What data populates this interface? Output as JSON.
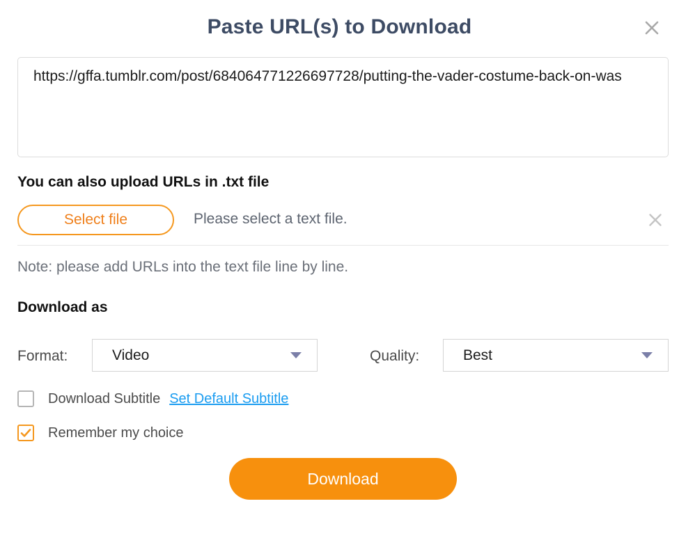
{
  "dialog": {
    "title": "Paste URL(s) to Download",
    "close_icon": "close-icon"
  },
  "url_input": {
    "value": "https://gffa.tumblr.com/post/684064771226697728/putting-the-vader-costume-back-on-was",
    "placeholder": "Paste URL(s) here"
  },
  "upload": {
    "heading": "You can also upload URLs in .txt file",
    "select_file_label": "Select file",
    "file_status": "Please select a text file.",
    "clear_icon": "close-icon",
    "note": "Note: please add URLs into the text file line by line."
  },
  "download_as": {
    "heading": "Download as",
    "format": {
      "label": "Format:",
      "value": "Video",
      "chevron": "chevron-down-icon"
    },
    "quality": {
      "label": "Quality:",
      "value": "Best",
      "chevron": "chevron-down-icon"
    }
  },
  "options": {
    "download_subtitle": {
      "label": "Download Subtitle",
      "checked": false
    },
    "set_default_subtitle_link": "Set Default Subtitle",
    "remember_my_choice": {
      "label": "Remember my choice",
      "checked": true
    }
  },
  "actions": {
    "download_label": "Download"
  },
  "colors": {
    "accent_orange": "#f7900d",
    "accent_orange_border": "#f5971d",
    "select_file_text": "#ef7f1a",
    "link_blue": "#1a9cf0",
    "title_navy": "#3d4b64",
    "chevron_purple": "#7b7fa8"
  }
}
